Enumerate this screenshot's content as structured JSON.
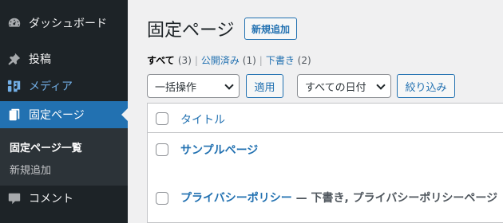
{
  "sidebar": {
    "items": [
      {
        "label": "ダッシュボード",
        "icon": "dashboard-icon"
      },
      {
        "label": "投稿",
        "icon": "pin-icon"
      },
      {
        "label": "メディア",
        "icon": "media-icon"
      },
      {
        "label": "固定ページ",
        "icon": "pages-icon"
      },
      {
        "label": "コメント",
        "icon": "comment-icon"
      }
    ],
    "submenu": {
      "active": "固定ページ一覧",
      "new": "新規追加"
    },
    "colors": {
      "bg": "#1d2327",
      "active": "#2271b1",
      "submenu_bg": "#2c3338"
    }
  },
  "header": {
    "title": "固定ページ",
    "add_new": "新規追加"
  },
  "filters": {
    "all": {
      "label": "すべて",
      "count": "(3)"
    },
    "published": {
      "label": "公開済み",
      "count": "(1)"
    },
    "drafts": {
      "label": "下書き",
      "count": "(2)"
    },
    "separator": "|"
  },
  "bulk": {
    "select_value": "一括操作",
    "apply": "適用",
    "dates_value": "すべての日付",
    "filter": "絞り込み"
  },
  "table": {
    "column_title": "タイトル",
    "rows": [
      {
        "title": "サンプルページ",
        "state": ""
      },
      {
        "title": "プライバシーポリシー",
        "state": " — 下書き, プライバシーポリシーページ"
      }
    ]
  }
}
